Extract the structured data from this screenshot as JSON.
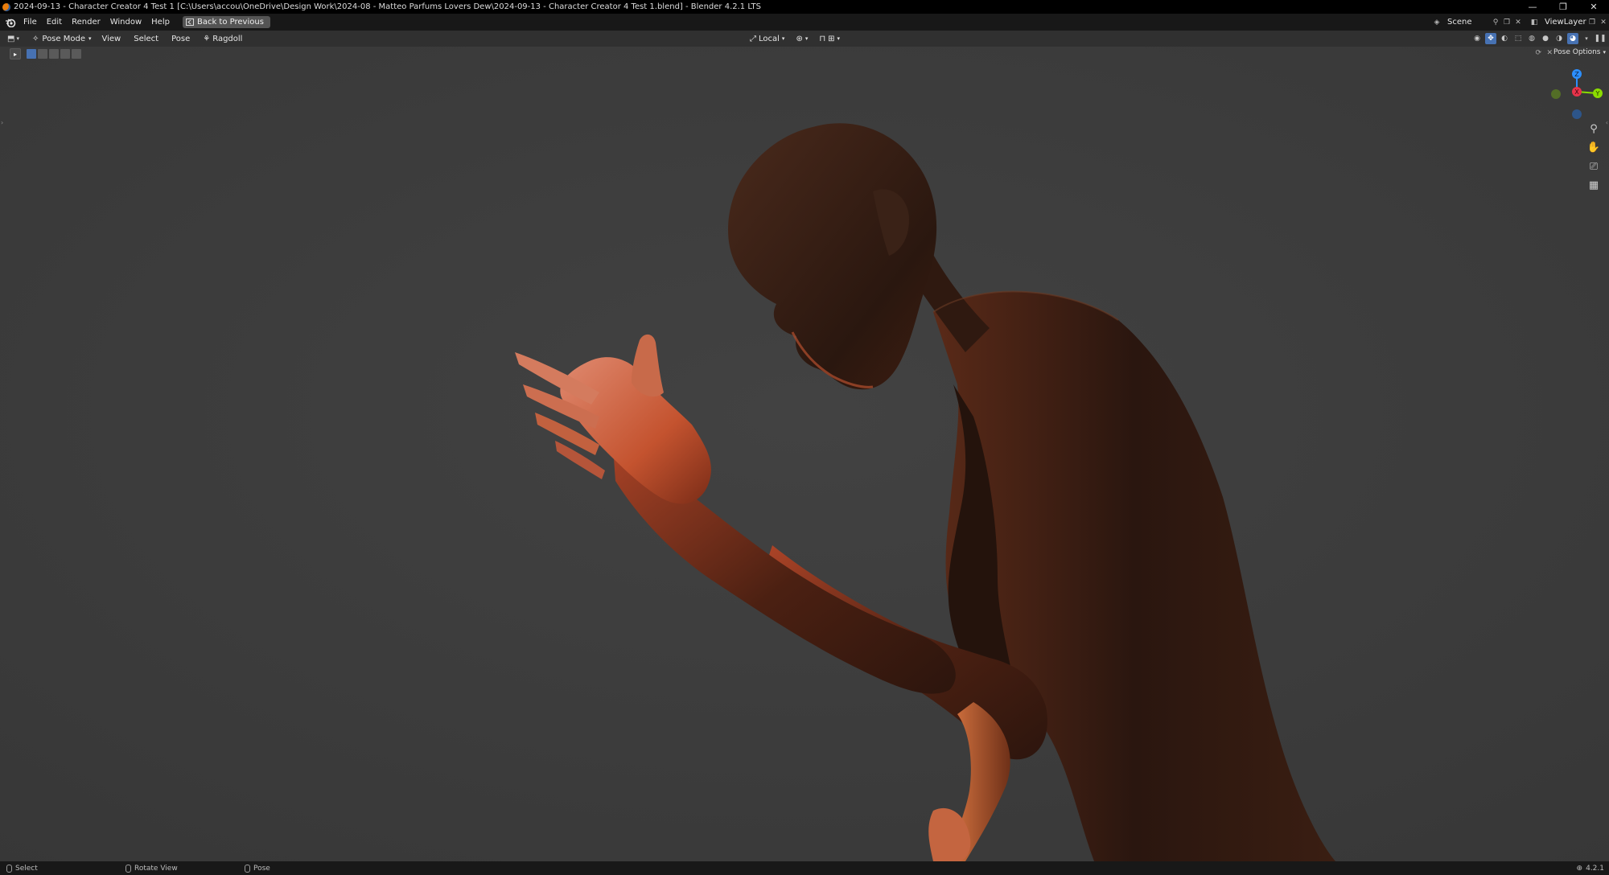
{
  "window": {
    "title": "2024-09-13 - Character Creator 4 Test 1 [C:\\Users\\accou\\OneDrive\\Design Work\\2024-08 - Matteo Parfums Lovers Dew\\2024-09-13 - Character Creator 4 Test 1.blend] - Blender 4.2.1 LTS",
    "minimize": "—",
    "maximize": "❐",
    "close": "✕"
  },
  "menubar": {
    "items": [
      "File",
      "Edit",
      "Render",
      "Window",
      "Help"
    ],
    "back_button": "Back to Previous",
    "scene": "Scene",
    "view_layer": "ViewLayer"
  },
  "viewport_header": {
    "mode": "Pose Mode",
    "menus": [
      "View",
      "Select",
      "Pose",
      "Ragdoll"
    ],
    "transform_orientation": "Local"
  },
  "tool_settings": {
    "pose_options": "Pose Options"
  },
  "gizmo": {
    "z_label": "Z",
    "x_label": "X",
    "y_label": "Y",
    "colors": {
      "x": "#e8334a",
      "y": "#8bdc00",
      "z": "#2c8fff"
    }
  },
  "statusbar": {
    "select": "Select",
    "rotate_view": "Rotate View",
    "pose": "Pose",
    "version": "4.2.1"
  },
  "icons": {
    "navigation": [
      "zoom-icon",
      "pan-hand-icon",
      "camera-view-icon",
      "ortho-grid-icon"
    ]
  }
}
